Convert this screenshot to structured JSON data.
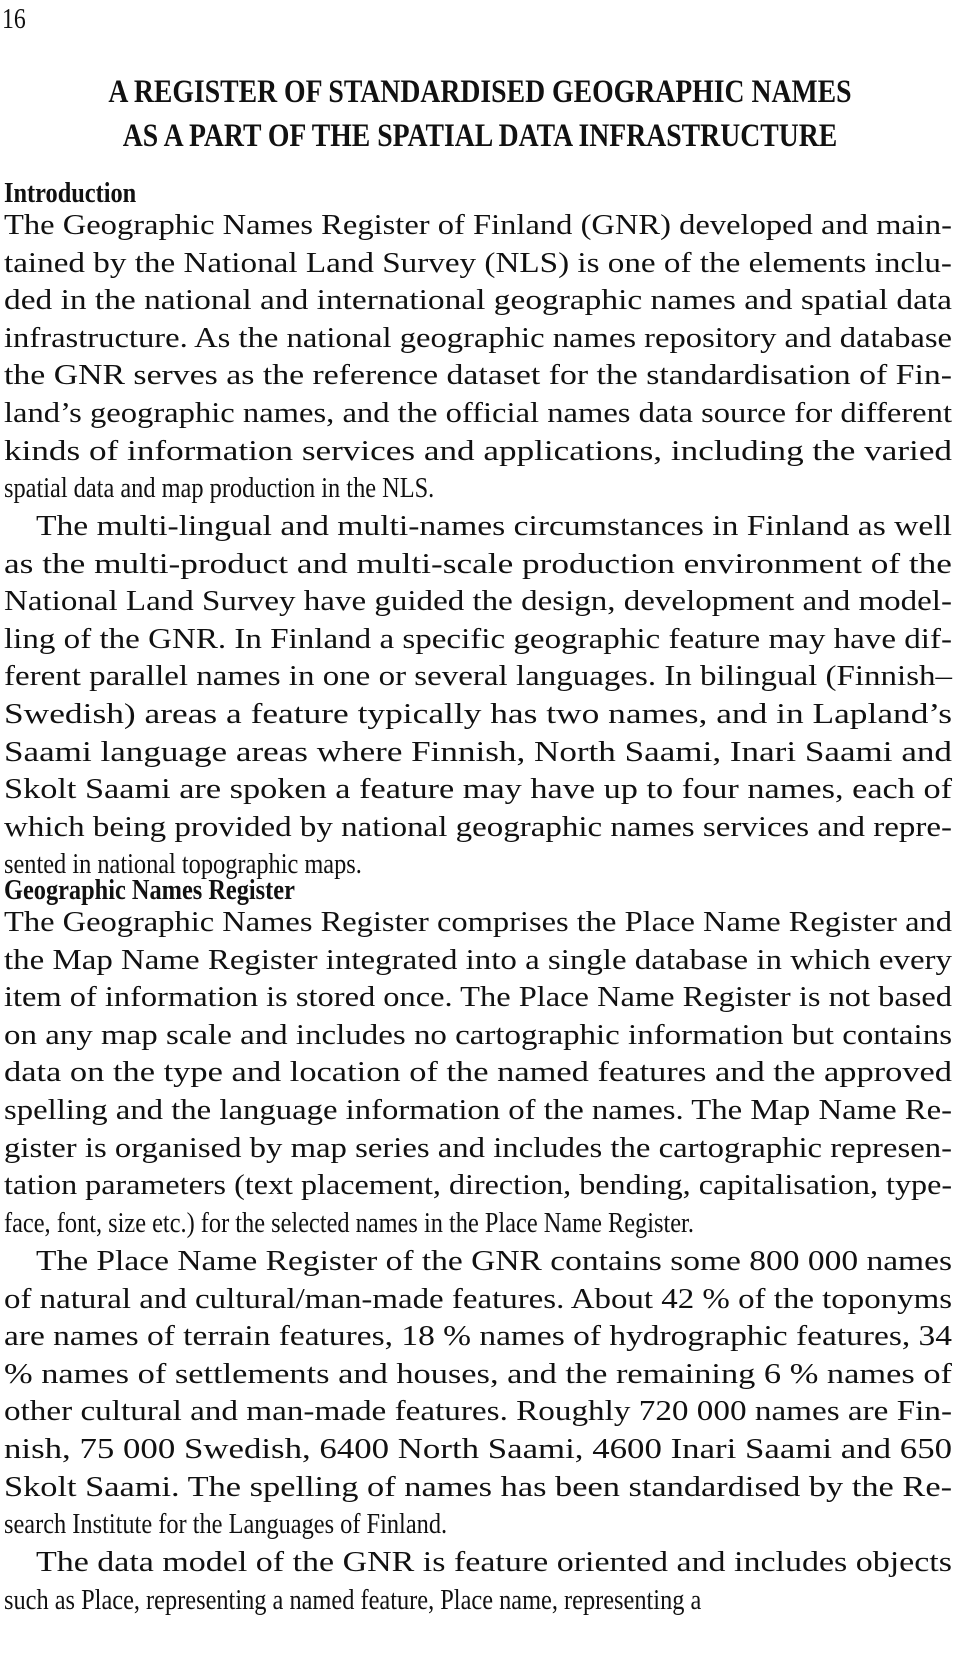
{
  "page_number": "16",
  "title": {
    "lines": [
      "A REGISTER OF STANDARDISED GEOGRAPHIC NAMES",
      "AS A PART OF THE SPATIAL DATA INFRASTRUCTURE"
    ]
  },
  "sections": [
    {
      "heading": "Introduction",
      "paragraphs": [
        {
          "indent": false,
          "lines": [
            "The Geographic Names Register of Finland (GNR) developed and main-",
            "tained by the National Land Survey (NLS) is one of the elements inclu-",
            "ded in the national and international geographic names and spatial data",
            "infrastructure. As the national geographic names repository and database",
            "the GNR serves as the reference dataset for the standardisation of Fin-",
            "land’s geographic names, and the official names data source for different",
            "kinds of information services and applications, including the varied",
            "spatial data and map production in the NLS."
          ]
        },
        {
          "indent": true,
          "lines": [
            "The multi-lingual and multi-names circumstances in Finland as well",
            "as the multi-product and multi-scale production environment of the",
            "National Land Survey have guided the design, development and model-",
            "ling of the GNR. In Finland a specific geographic feature may have dif-",
            "ferent parallel names in one or several languages. In bilingual (Finnish–",
            "Swedish) areas a feature typically has two names, and in Lapland’s",
            "Saami language areas where Finnish, North Saami, Inari Saami and",
            "Skolt Saami are spoken a feature may have up to four names, each of",
            "which being provided by national geographic names services and repre-",
            "sented in national topographic maps."
          ]
        }
      ]
    },
    {
      "heading": "Geographic Names Register",
      "paragraphs": [
        {
          "indent": false,
          "lines": [
            "The Geographic Names Register comprises the Place Name Register and",
            "the Map Name Register integrated into a single database in which every",
            "item of information is stored once. The Place Name Register is not based",
            "on any map scale and includes no cartographic information but contains",
            "data on the type and location of the named features and the approved",
            "spelling and the language information of the names. The Map Name Re-",
            "gister is organised by map series and includes the cartographic represen-",
            "tation parameters (text placement, direction, bending, capitalisation, type-",
            "face, font, size etc.) for the selected names in the Place Name Register."
          ]
        },
        {
          "indent": true,
          "lines": [
            "The Place Name Register of the GNR contains some 800 000 names",
            "of natural and cultural/man-made features. About 42 % of the toponyms",
            "are names of terrain features, 18 % names of hydrographic features, 34",
            "% names of settlements and houses, and the remaining 6 % names of",
            "other cultural and man-made features. Roughly 720 000 names are Fin-",
            "nish, 75 000 Swedish, 6400 North Saami, 4600 Inari Saami and 650",
            "Skolt Saami. The spelling of names has been standardised by the Re-",
            "search Institute for the Languages of Finland."
          ]
        },
        {
          "indent": true,
          "lines": [
            "The data model of the GNR is feature oriented and includes objects",
            "such as Place, representing a named feature, Place name, representing a"
          ]
        }
      ]
    }
  ]
}
